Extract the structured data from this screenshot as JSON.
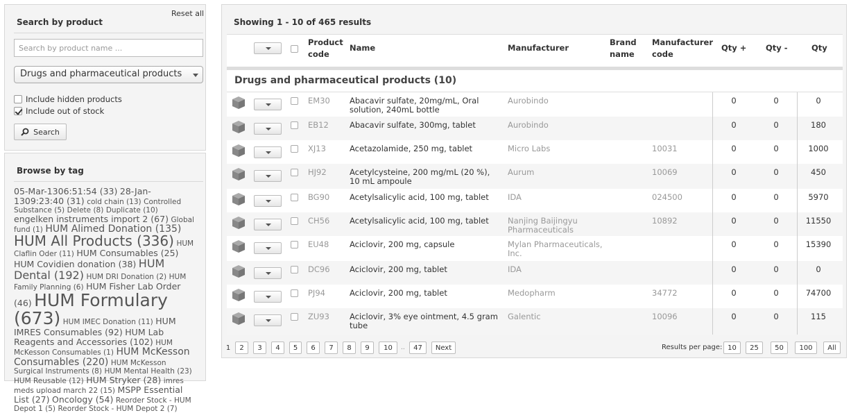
{
  "search": {
    "reset_label": "Reset all",
    "title": "Search by product",
    "placeholder": "Search by product name ...",
    "category": "Drugs and pharmaceutical products",
    "include_hidden_label": "Include hidden products",
    "include_hidden_checked": false,
    "include_oos_label": "Include out of stock",
    "include_oos_checked": true,
    "button_label": "Search"
  },
  "tags": {
    "title": "Browse by tag",
    "items": [
      {
        "text": "05-Mar-1306:51:54 (33)",
        "size": "t2"
      },
      {
        "text": "28-Jan-1309:23:40 (31)",
        "size": "t2"
      },
      {
        "text": "cold chain (13)",
        "size": "t1"
      },
      {
        "text": "Controlled Substance (5)",
        "size": "t1"
      },
      {
        "text": "Delete (8)",
        "size": "t1"
      },
      {
        "text": "Duplicate (10)",
        "size": "t1"
      },
      {
        "text": "engelken instruments import 2 (67)",
        "size": "t2"
      },
      {
        "text": "Global fund (1)",
        "size": "t1"
      },
      {
        "text": "HUM Alimed Donation (135)",
        "size": "t3"
      },
      {
        "text": "HUM All Products (336)",
        "size": "t5"
      },
      {
        "text": "HUM Claflin Oder (11)",
        "size": "t1"
      },
      {
        "text": "HUM Consumables (25)",
        "size": "t2"
      },
      {
        "text": "HUM Covidien donation (38)",
        "size": "t2"
      },
      {
        "text": "HUM Dental (192)",
        "size": "t4"
      },
      {
        "text": "HUM DRI Donation (2)",
        "size": "t1"
      },
      {
        "text": "HUM Family Planning (6)",
        "size": "t1"
      },
      {
        "text": "HUM Fisher Lab Order (46)",
        "size": "t2"
      },
      {
        "text": "HUM Formulary (673)",
        "size": "t6"
      },
      {
        "text": "HUM IMEC Donation (11)",
        "size": "t1"
      },
      {
        "text": "HUM IMRES Consumables (92)",
        "size": "t2"
      },
      {
        "text": "HUM Lab Reagents and Accessories (102)",
        "size": "t2"
      },
      {
        "text": "HUM McKesson Consumables (1)",
        "size": "t1"
      },
      {
        "text": "HUM McKesson Consumables (220)",
        "size": "t3"
      },
      {
        "text": "HUM McKesson Surgical Instruments (8)",
        "size": "t1"
      },
      {
        "text": "HUM Mental Health (23)",
        "size": "t1"
      },
      {
        "text": "HUM Reusable (12)",
        "size": "t1"
      },
      {
        "text": "HUM Stryker (28)",
        "size": "t2"
      },
      {
        "text": "imres meds upload march 22 (15)",
        "size": "t1"
      },
      {
        "text": "MSPP Essential List (27)",
        "size": "t2"
      },
      {
        "text": "Oncology (54)",
        "size": "t2"
      },
      {
        "text": "Reorder Stock - HUM Depot 1 (5)",
        "size": "t1"
      },
      {
        "text": "Reorder Stock - HUM Depot 2 (7)",
        "size": "t1"
      }
    ]
  },
  "results": {
    "showing": "Showing 1 - 10 of 465 results",
    "headers": {
      "product_code": "Product\ncode",
      "name": "Name",
      "manufacturer": "Manufacturer",
      "brand_name": "Brand\nname",
      "manufacturer_code": "Manufacturer\ncode",
      "qty_plus": "Qty +",
      "qty_minus": "Qty -",
      "qty": "Qty"
    },
    "group": "Drugs and pharmaceutical products (10)",
    "rows": [
      {
        "code": "EM30",
        "name": "Abacavir sulfate, 20mg/mL, Oral solution, 240mL bottle",
        "manufacturer": "Aurobindo",
        "brand": "",
        "mcode": "",
        "qplus": "0",
        "qminus": "0",
        "qty": "0"
      },
      {
        "code": "EB12",
        "name": "Abacavir sulfate, 300mg, tablet",
        "manufacturer": "Aurobindo",
        "brand": "",
        "mcode": "",
        "qplus": "0",
        "qminus": "0",
        "qty": "180"
      },
      {
        "code": "XJ13",
        "name": "Acetazolamide, 250 mg, tablet",
        "manufacturer": "Micro Labs",
        "brand": "",
        "mcode": "10031",
        "qplus": "0",
        "qminus": "0",
        "qty": "1000"
      },
      {
        "code": "HJ92",
        "name": "Acetylcysteine, 200 mg/mL (20 %), 10 mL ampoule",
        "manufacturer": "Aurum",
        "brand": "",
        "mcode": "10069",
        "qplus": "0",
        "qminus": "0",
        "qty": "450"
      },
      {
        "code": "BG90",
        "name": "Acetylsalicylic acid, 100 mg, tablet",
        "manufacturer": "IDA",
        "brand": "",
        "mcode": "024500",
        "qplus": "0",
        "qminus": "0",
        "qty": "5970"
      },
      {
        "code": "CH56",
        "name": "Acetylsalicylic acid, 100 mg, tablet",
        "manufacturer": "Nanjing Baijingyu Pharmaceuticals",
        "brand": "",
        "mcode": "10892",
        "qplus": "0",
        "qminus": "0",
        "qty": "11550"
      },
      {
        "code": "EU48",
        "name": "Aciclovir, 200 mg, capsule",
        "manufacturer": "Mylan Pharmaceuticals, Inc.",
        "brand": "",
        "mcode": "",
        "qplus": "0",
        "qminus": "0",
        "qty": "15390"
      },
      {
        "code": "DC96",
        "name": "Aciclovir, 200 mg, tablet",
        "manufacturer": "IDA",
        "brand": "",
        "mcode": "",
        "qplus": "0",
        "qminus": "0",
        "qty": "0"
      },
      {
        "code": "PJ94",
        "name": "Aciclovir, 200 mg, tablet",
        "manufacturer": "Medopharm",
        "brand": "",
        "mcode": "34772",
        "qplus": "0",
        "qminus": "0",
        "qty": "74700"
      },
      {
        "code": "ZU93",
        "name": "Aciclovir, 3% eye ointment, 4.5 gram tube",
        "manufacturer": "Galentic",
        "brand": "",
        "mcode": "10096",
        "qplus": "0",
        "qminus": "0",
        "qty": "115"
      }
    ]
  },
  "pagination": {
    "current": "1",
    "pages": [
      "2",
      "3",
      "4",
      "5",
      "6",
      "7",
      "8",
      "9",
      "10"
    ],
    "ellipsis": "..",
    "last": "47",
    "next": "Next",
    "rpp_label": "Results per page:",
    "rpp_options": [
      "10",
      "25",
      "50",
      "100",
      "All"
    ]
  }
}
